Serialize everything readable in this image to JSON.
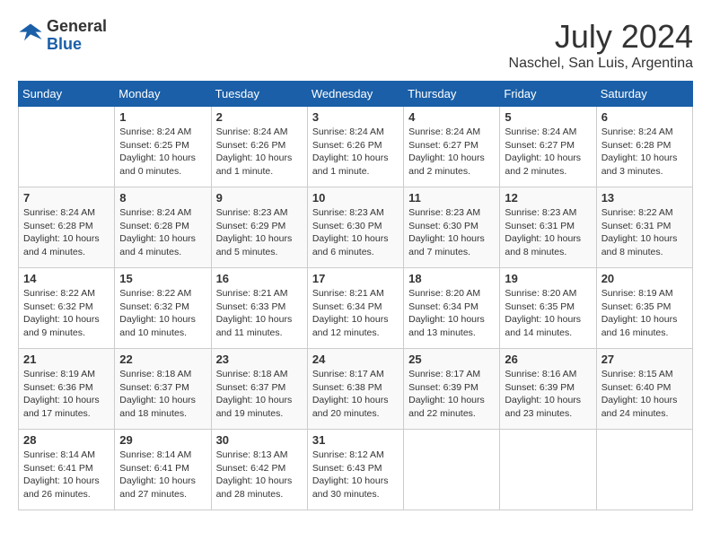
{
  "header": {
    "logo_general": "General",
    "logo_blue": "Blue",
    "month_year": "July 2024",
    "location": "Naschel, San Luis, Argentina"
  },
  "days_of_week": [
    "Sunday",
    "Monday",
    "Tuesday",
    "Wednesday",
    "Thursday",
    "Friday",
    "Saturday"
  ],
  "weeks": [
    [
      {
        "day": "",
        "content": ""
      },
      {
        "day": "1",
        "content": "Sunrise: 8:24 AM\nSunset: 6:25 PM\nDaylight: 10 hours\nand 0 minutes."
      },
      {
        "day": "2",
        "content": "Sunrise: 8:24 AM\nSunset: 6:26 PM\nDaylight: 10 hours\nand 1 minute."
      },
      {
        "day": "3",
        "content": "Sunrise: 8:24 AM\nSunset: 6:26 PM\nDaylight: 10 hours\nand 1 minute."
      },
      {
        "day": "4",
        "content": "Sunrise: 8:24 AM\nSunset: 6:27 PM\nDaylight: 10 hours\nand 2 minutes."
      },
      {
        "day": "5",
        "content": "Sunrise: 8:24 AM\nSunset: 6:27 PM\nDaylight: 10 hours\nand 2 minutes."
      },
      {
        "day": "6",
        "content": "Sunrise: 8:24 AM\nSunset: 6:28 PM\nDaylight: 10 hours\nand 3 minutes."
      }
    ],
    [
      {
        "day": "7",
        "content": "Sunrise: 8:24 AM\nSunset: 6:28 PM\nDaylight: 10 hours\nand 4 minutes."
      },
      {
        "day": "8",
        "content": "Sunrise: 8:24 AM\nSunset: 6:28 PM\nDaylight: 10 hours\nand 4 minutes."
      },
      {
        "day": "9",
        "content": "Sunrise: 8:23 AM\nSunset: 6:29 PM\nDaylight: 10 hours\nand 5 minutes."
      },
      {
        "day": "10",
        "content": "Sunrise: 8:23 AM\nSunset: 6:30 PM\nDaylight: 10 hours\nand 6 minutes."
      },
      {
        "day": "11",
        "content": "Sunrise: 8:23 AM\nSunset: 6:30 PM\nDaylight: 10 hours\nand 7 minutes."
      },
      {
        "day": "12",
        "content": "Sunrise: 8:23 AM\nSunset: 6:31 PM\nDaylight: 10 hours\nand 8 minutes."
      },
      {
        "day": "13",
        "content": "Sunrise: 8:22 AM\nSunset: 6:31 PM\nDaylight: 10 hours\nand 8 minutes."
      }
    ],
    [
      {
        "day": "14",
        "content": "Sunrise: 8:22 AM\nSunset: 6:32 PM\nDaylight: 10 hours\nand 9 minutes."
      },
      {
        "day": "15",
        "content": "Sunrise: 8:22 AM\nSunset: 6:32 PM\nDaylight: 10 hours\nand 10 minutes."
      },
      {
        "day": "16",
        "content": "Sunrise: 8:21 AM\nSunset: 6:33 PM\nDaylight: 10 hours\nand 11 minutes."
      },
      {
        "day": "17",
        "content": "Sunrise: 8:21 AM\nSunset: 6:34 PM\nDaylight: 10 hours\nand 12 minutes."
      },
      {
        "day": "18",
        "content": "Sunrise: 8:20 AM\nSunset: 6:34 PM\nDaylight: 10 hours\nand 13 minutes."
      },
      {
        "day": "19",
        "content": "Sunrise: 8:20 AM\nSunset: 6:35 PM\nDaylight: 10 hours\nand 14 minutes."
      },
      {
        "day": "20",
        "content": "Sunrise: 8:19 AM\nSunset: 6:35 PM\nDaylight: 10 hours\nand 16 minutes."
      }
    ],
    [
      {
        "day": "21",
        "content": "Sunrise: 8:19 AM\nSunset: 6:36 PM\nDaylight: 10 hours\nand 17 minutes."
      },
      {
        "day": "22",
        "content": "Sunrise: 8:18 AM\nSunset: 6:37 PM\nDaylight: 10 hours\nand 18 minutes."
      },
      {
        "day": "23",
        "content": "Sunrise: 8:18 AM\nSunset: 6:37 PM\nDaylight: 10 hours\nand 19 minutes."
      },
      {
        "day": "24",
        "content": "Sunrise: 8:17 AM\nSunset: 6:38 PM\nDaylight: 10 hours\nand 20 minutes."
      },
      {
        "day": "25",
        "content": "Sunrise: 8:17 AM\nSunset: 6:39 PM\nDaylight: 10 hours\nand 22 minutes."
      },
      {
        "day": "26",
        "content": "Sunrise: 8:16 AM\nSunset: 6:39 PM\nDaylight: 10 hours\nand 23 minutes."
      },
      {
        "day": "27",
        "content": "Sunrise: 8:15 AM\nSunset: 6:40 PM\nDaylight: 10 hours\nand 24 minutes."
      }
    ],
    [
      {
        "day": "28",
        "content": "Sunrise: 8:14 AM\nSunset: 6:41 PM\nDaylight: 10 hours\nand 26 minutes."
      },
      {
        "day": "29",
        "content": "Sunrise: 8:14 AM\nSunset: 6:41 PM\nDaylight: 10 hours\nand 27 minutes."
      },
      {
        "day": "30",
        "content": "Sunrise: 8:13 AM\nSunset: 6:42 PM\nDaylight: 10 hours\nand 28 minutes."
      },
      {
        "day": "31",
        "content": "Sunrise: 8:12 AM\nSunset: 6:43 PM\nDaylight: 10 hours\nand 30 minutes."
      },
      {
        "day": "",
        "content": ""
      },
      {
        "day": "",
        "content": ""
      },
      {
        "day": "",
        "content": ""
      }
    ]
  ]
}
